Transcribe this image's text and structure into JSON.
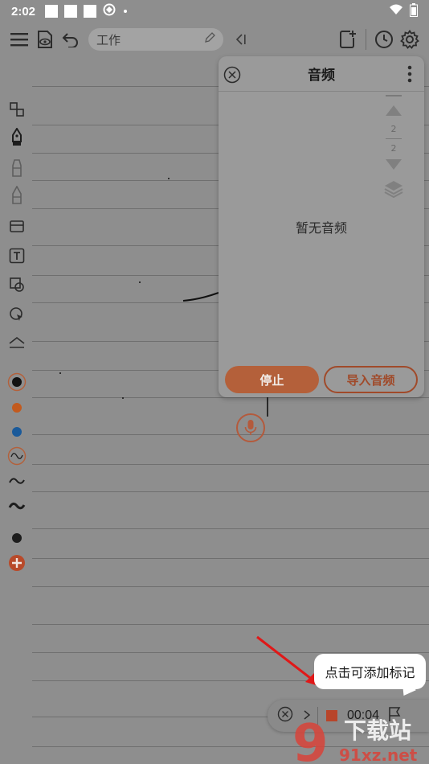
{
  "status_bar": {
    "time": "2:02"
  },
  "toolbar": {
    "search_text": "工作"
  },
  "panel": {
    "title": "音频",
    "empty_text": "暂无音频",
    "stop_label": "停止",
    "import_label": "导入音频"
  },
  "pager": {
    "current": "2",
    "total": "2"
  },
  "recording": {
    "time": "00:04"
  },
  "tooltip": {
    "text": "点击可添加标记"
  },
  "watermark": {
    "text1": "下载站",
    "text2": "91xz.net",
    "logo": "9"
  },
  "colors": {
    "accent": "#b4603a",
    "pen_orange": "#c25a1e",
    "pen_blue": "#1a5a9a",
    "pen_black": "#111111"
  }
}
